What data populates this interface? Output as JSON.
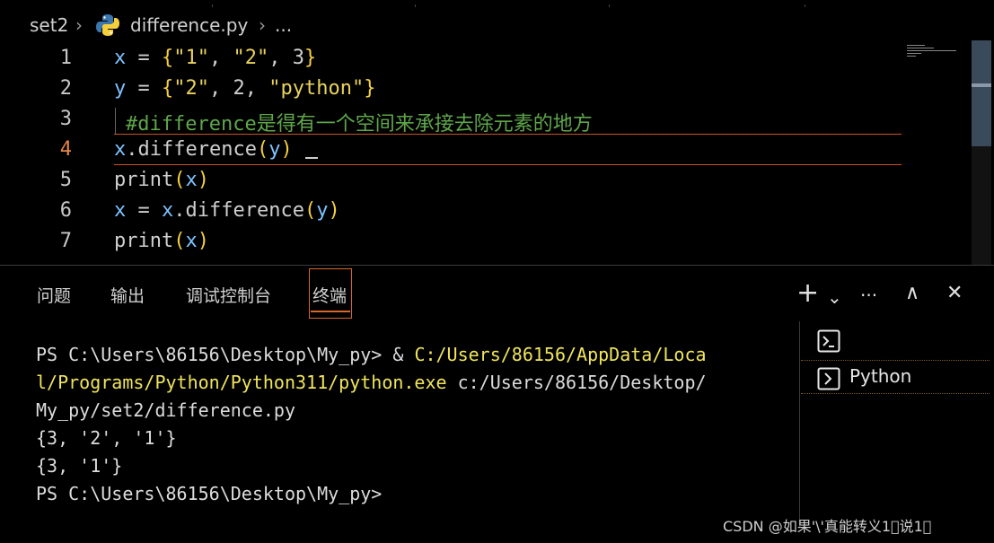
{
  "breadcrumb": {
    "folder": "set2",
    "file": "difference.py",
    "more": "...",
    "chevron": "›",
    "file_icon": "python-icon"
  },
  "editor": {
    "active_line": 4,
    "lines": [
      {
        "num": "1"
      },
      {
        "num": "2"
      },
      {
        "num": "3"
      },
      {
        "num": "4"
      },
      {
        "num": "5"
      },
      {
        "num": "6"
      },
      {
        "num": "7"
      }
    ],
    "code": {
      "l1": {
        "var": "x",
        "eq": " = ",
        "ob": "{",
        "s1": "\"1\"",
        "c1": ", ",
        "s2": "\"2\"",
        "c2": ", ",
        "n": "3",
        "cb": "}"
      },
      "l2": {
        "var": "y",
        "eq": " = ",
        "ob": "{",
        "s1": "\"2\"",
        "c1": ", ",
        "n": "2",
        "c2": ", ",
        "s2": "\"python\"",
        "cb": "}"
      },
      "l3": {
        "comment": "#difference是得有一个空间来承接去除元素的地方"
      },
      "l4": {
        "var": "x",
        "fn": ".difference",
        "op": "(",
        "arg": "y",
        "cp": ")"
      },
      "l5": {
        "fn": "print",
        "op": "(",
        "arg": "x",
        "cp": ")"
      },
      "l6": {
        "var": "x",
        "eq": " = ",
        "var2": "x",
        "fn": ".difference",
        "op": "(",
        "arg": "y",
        "cp": ")"
      },
      "l7": {
        "fn": "print",
        "op": "(",
        "arg": "x",
        "cp": ")"
      }
    }
  },
  "panel": {
    "tabs": [
      "问题",
      "输出",
      "调试控制台",
      "终端"
    ],
    "active_tab": "终端",
    "buttons": {
      "add": "+",
      "dropdown": "⌄",
      "more": "···",
      "maximize": "∧",
      "close": "✕"
    }
  },
  "terminal": {
    "lines": [
      {
        "plain": "PS C:\\Users\\86156\\Desktop\\My_py> & ",
        "yellow": "C:/Users/86156/AppData/Loca"
      },
      {
        "yellow": "l/Programs/Python/Python311/python.exe",
        "plain": " c:/Users/86156/Desktop/"
      },
      {
        "plain": "My_py/set2/difference.py"
      },
      {
        "plain": "{3, '2', '1'}"
      },
      {
        "plain": "{3, '1'}"
      },
      {
        "plain": "PS C:\\Users\\86156\\Desktop\\My_py>"
      }
    ]
  },
  "terminal_list": [
    {
      "label": "",
      "icon": "terminal-icon"
    },
    {
      "label": "Python",
      "icon": "terminal-icon"
    }
  ],
  "watermark": "CSDN @如果'\\'真能转义1\u0000说1\u0000",
  "colors": {
    "accent": "#d6682c",
    "string": "#e9d35c",
    "variable": "#7ec2ff",
    "comment": "#5ea64a"
  }
}
